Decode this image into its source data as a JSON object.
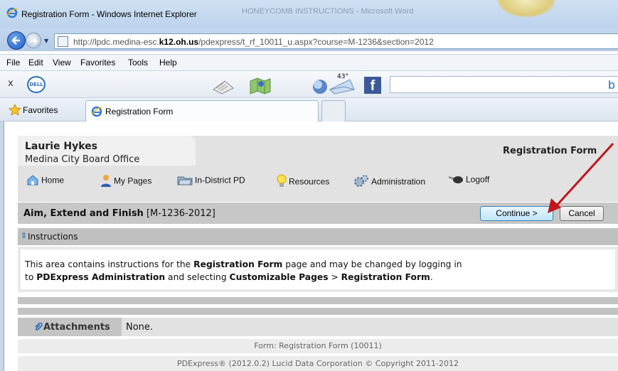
{
  "window": {
    "title": "Registration Form - Windows Internet Explorer",
    "background_tab": "HONEYCOMB INSTRUCTIONS - Microsoft Word"
  },
  "address": {
    "url_prefix": "http://lpdc.medina-esc.",
    "url_bold": "k12.oh.us",
    "url_suffix": "/pdexpress/t_rf_10011_u.aspx?course=M-1236&section=2012"
  },
  "menu": [
    "File",
    "Edit",
    "View",
    "Favorites",
    "Tools",
    "Help"
  ],
  "toolbar": {
    "close": "x",
    "dell": "DELL",
    "temperature": "43°",
    "facebook": "f",
    "search_partial": "b"
  },
  "favorites": {
    "label": "Favorites",
    "tab_label": "Registration Form"
  },
  "header": {
    "user_name": "Laurie Hykes",
    "office": "Medina City Board Office",
    "page_title": "Registration Form"
  },
  "nav": [
    {
      "label": "Home",
      "icon": "home-icon"
    },
    {
      "label": "My Pages",
      "icon": "person-icon"
    },
    {
      "label": "In-District PD",
      "icon": "folder-icon"
    },
    {
      "label": "Resources",
      "icon": "lightbulb-icon"
    },
    {
      "label": "Administration",
      "icon": "gears-icon"
    },
    {
      "label": "Logoff",
      "icon": "key-icon"
    }
  ],
  "course": {
    "name": "Aim, Extend and Finish",
    "code": "[M-1236-2012]",
    "continue_label": "Continue >",
    "cancel_label": "Cancel"
  },
  "instructions": {
    "heading": "Instructions",
    "line1_a": "This area contains instructions for the ",
    "line1_b": "Registration Form",
    "line1_c": " page and may be changed by logging in",
    "line2_a": "to ",
    "line2_b": "PDExpress Administration",
    "line2_c": " and selecting ",
    "line2_d": "Customizable Pages",
    "line2_e": " > ",
    "line2_f": "Registration Form",
    "line2_g": "."
  },
  "attachments": {
    "label": "Attachments",
    "value": "None."
  },
  "footer": {
    "form": "Form: Registration Form (10011)",
    "copyright": "PDExpress® (2012.0.2) Lucid Data Corporation © Copyright 2011-2012"
  },
  "colors": {
    "annotation_arrow": "#c0151a",
    "continue_button": "#bde6fd"
  }
}
